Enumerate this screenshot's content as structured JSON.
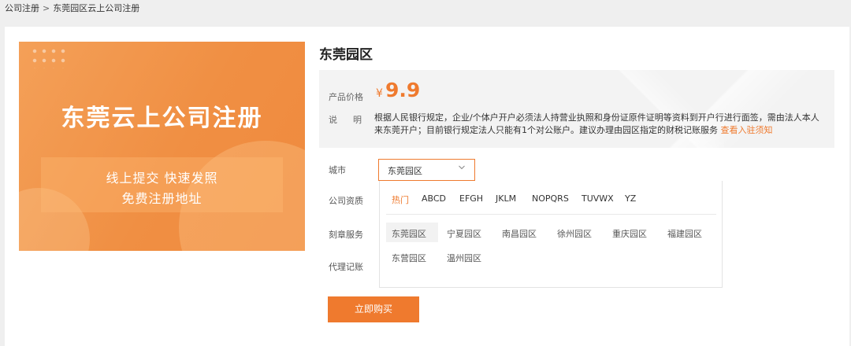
{
  "breadcrumb": {
    "root": "公司注册",
    "separator": ">",
    "current": "东莞园区云上公司注册"
  },
  "banner": {
    "title": "东莞云上公司注册",
    "subtitle_line1": "线上提交 快速发照",
    "subtitle_line2": "免费注册地址"
  },
  "product": {
    "title": "东莞园区",
    "price_label": "产品价格",
    "currency": "¥",
    "price": "9.9",
    "desc_label": "说明",
    "desc_text": "根据人民银行规定，企业/个体户开户必须法人持营业执照和身份证原件证明等资料到开户行进行面签，需由法人本人来东莞开户；目前银行规定法人只能有1个对公账户。建议办理由园区指定的财税记账服务 ",
    "desc_link": "查看入驻须知"
  },
  "form": {
    "city_label": "城市",
    "qualification_label": "公司资质",
    "seal_label": "刻章服务",
    "accounting_label": "代理记账",
    "city_value": "东莞园区"
  },
  "dropdown": {
    "tabs": [
      "热门",
      "ABCD",
      "EFGH",
      "JKLM",
      "NOPQRS",
      "TUVWX",
      "YZ"
    ],
    "active_tab": "热门",
    "parks": [
      "东莞园区",
      "宁夏园区",
      "南昌园区",
      "徐州园区",
      "重庆园区",
      "福建园区",
      "东营园区",
      "温州园区"
    ],
    "selected_park": "东莞园区"
  },
  "buy_button": "立即购买",
  "colors": {
    "accent": "#ef7a2e",
    "panel_bg": "#f3f3f3",
    "page_bg": "#efefef"
  }
}
